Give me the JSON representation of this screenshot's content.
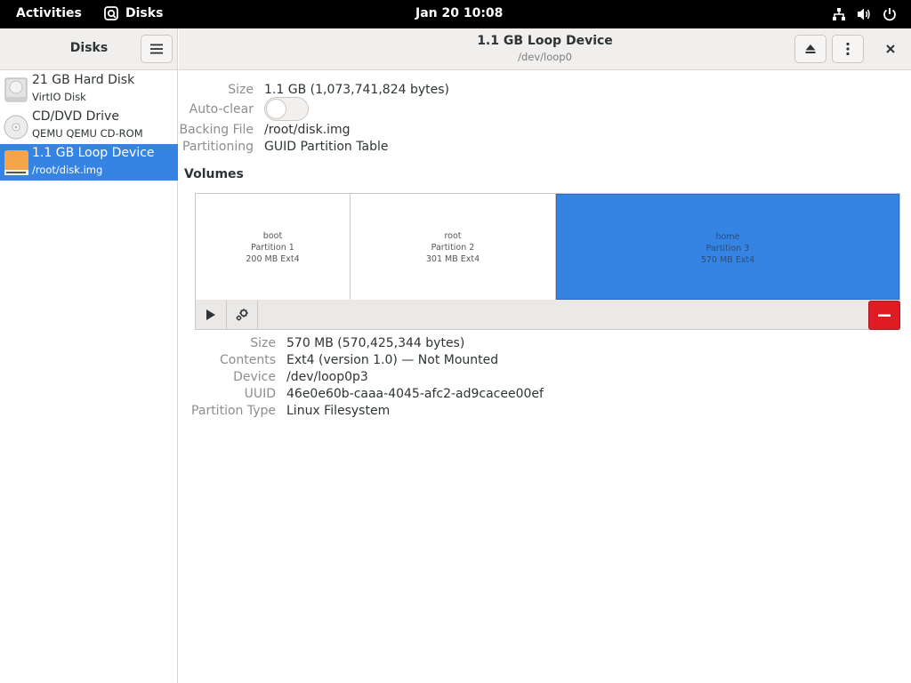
{
  "topbar": {
    "activities": "Activities",
    "app_name": "Disks",
    "clock": "Jan 20  10:08"
  },
  "sidebar": {
    "title": "Disks",
    "devices": [
      {
        "name": "21 GB Hard Disk",
        "sub": "VirtIO Disk",
        "icon": "hard-disk-icon"
      },
      {
        "name": "CD/DVD Drive",
        "sub": "QEMU QEMU CD-ROM",
        "icon": "optical-drive-icon"
      },
      {
        "name": "1.1 GB Loop Device",
        "sub": "/root/disk.img",
        "icon": "loop-device-icon",
        "selected": true
      }
    ]
  },
  "header": {
    "title": "1.1 GB Loop Device",
    "subtitle": "/dev/loop0"
  },
  "disk": {
    "size_label": "Size",
    "size_value": "1.1 GB (1,073,741,824 bytes)",
    "autoclear_label": "Auto-clear",
    "autoclear_on": false,
    "backing_label": "Backing File",
    "backing_value": "/root/disk.img",
    "partitioning_label": "Partitioning",
    "partitioning_value": "GUID Partition Table"
  },
  "volumes": {
    "title": "Volumes",
    "partitions": [
      {
        "name": "boot",
        "number": "Partition 1",
        "detail": "200 MB Ext4"
      },
      {
        "name": "root",
        "number": "Partition 2",
        "detail": "301 MB Ext4"
      },
      {
        "name": "home",
        "number": "Partition 3",
        "detail": "570 MB Ext4",
        "selected": true
      }
    ]
  },
  "partition_props": {
    "size_label": "Size",
    "size_value": "570 MB (570,425,344 bytes)",
    "contents_label": "Contents",
    "contents_value": "Ext4 (version 1.0) — Not Mounted",
    "device_label": "Device",
    "device_value": "/dev/loop0p3",
    "uuid_label": "UUID",
    "uuid_value": "46e0e60b-caaa-4045-afc2-ad9cacee00ef",
    "type_label": "Partition Type",
    "type_value": "Linux Filesystem"
  },
  "colors": {
    "accent": "#3584e4",
    "destructive": "#e01b24"
  }
}
